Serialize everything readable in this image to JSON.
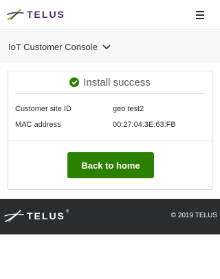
{
  "header": {
    "brand": "TELUS",
    "brand_color": "#4b286d",
    "menu_icon": "hamburger-menu-icon"
  },
  "subnav": {
    "console_label": "IoT Customer Console",
    "dropdown_icon": "chevron-down-icon"
  },
  "result": {
    "status_icon": "check-circle-icon",
    "status_text": "Install success",
    "status_color": "#2b8000",
    "fields": [
      {
        "label": "Customer site ID",
        "value": "geo test2"
      },
      {
        "label": "MAC address",
        "value": "00:27:04:3E:63:FB"
      }
    ],
    "home_button_label": "Back to home",
    "button_color": "#2b8000"
  },
  "footer": {
    "brand": "TELUS",
    "registered_mark": "®",
    "copyright": "© 2019 TELUS",
    "background": "#2a2c2e"
  }
}
